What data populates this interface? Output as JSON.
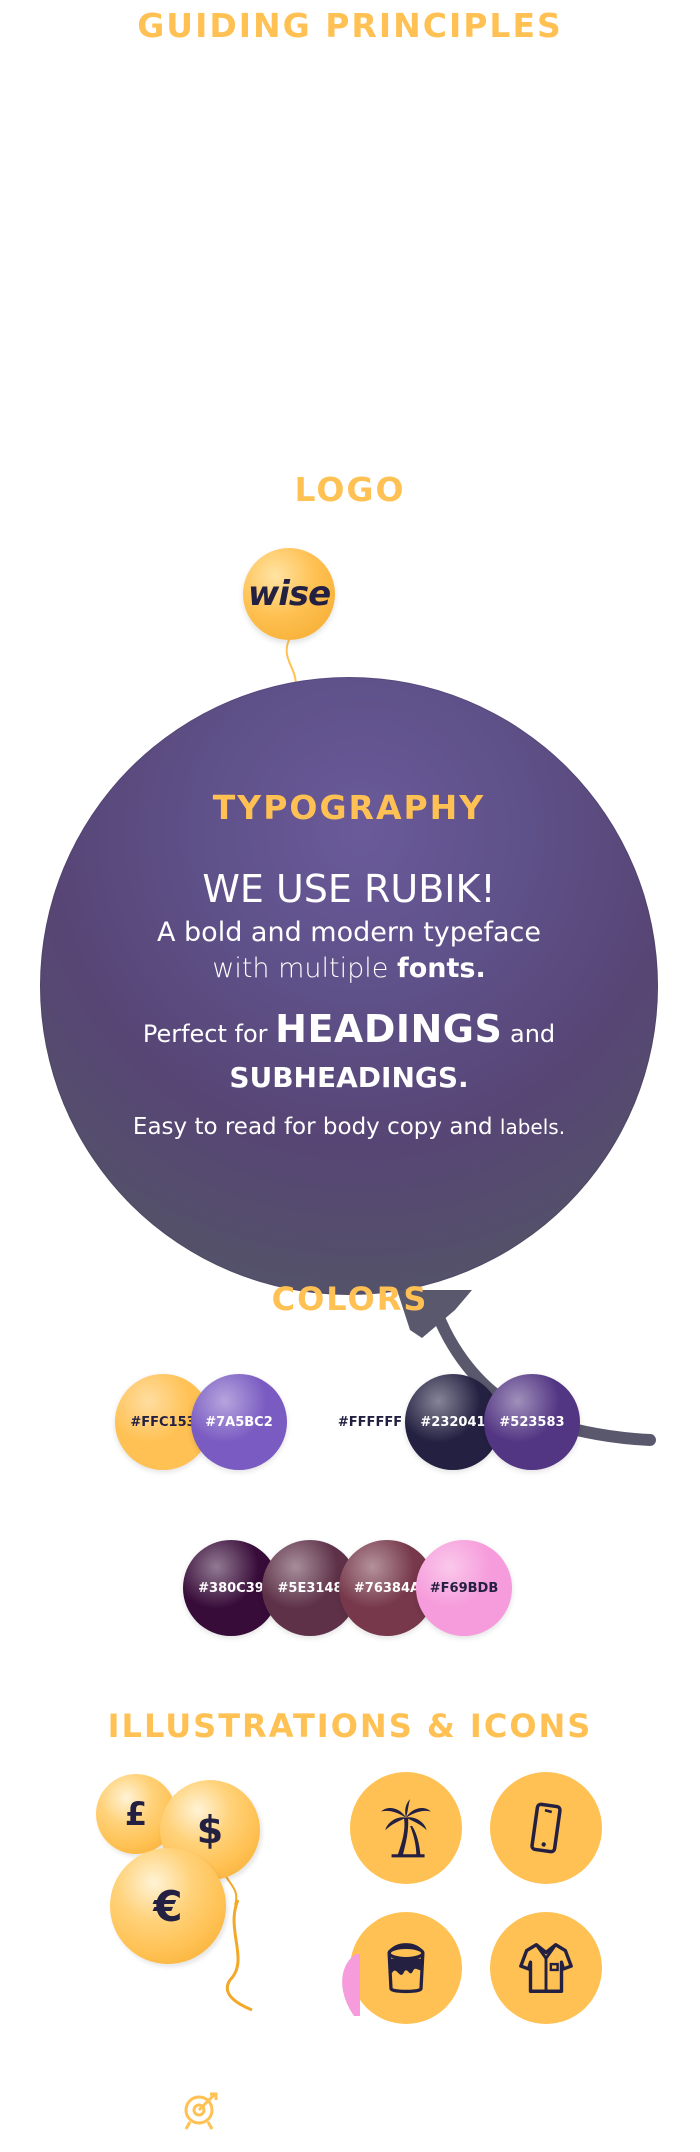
{
  "headings": {
    "guiding": "GUIDING  PRINCIPLES",
    "logo": "LOGO",
    "colors": "COLORS",
    "illustrations": "ILLUSTRATIONS & ICONS"
  },
  "logo": {
    "text": "wise",
    "color": "#FFC153"
  },
  "typography": {
    "title": "TYPOGRAPHY",
    "line1": "WE USE RUBIK!",
    "line2": "A bold and modern typeface",
    "line3_start": "with multiple ",
    "line3_bold": "fonts.",
    "line4_start": "Perfect for ",
    "line4_big": "HEADINGS",
    "line4_end": " and",
    "line5": "SUBHEADINGS.",
    "line6_start": "Easy to read for body copy and ",
    "line6_small": "labels."
  },
  "colors": {
    "row1": [
      {
        "label": "#FFC153",
        "hex": "#FFC153",
        "text": "#232041"
      },
      {
        "label": "#7A5BC2",
        "hex": "#7A5BC2",
        "text": "#FFFFFF"
      },
      {
        "label": "#FFFFFF",
        "hex": "#FFFFFF",
        "text": "#232041"
      },
      {
        "label": "#232041",
        "hex": "#232041",
        "text": "#FFFFFF"
      },
      {
        "label": "#523583",
        "hex": "#523583",
        "text": "#FFFFFF"
      }
    ],
    "row2": [
      {
        "label": "#380C39",
        "hex": "#380C39",
        "text": "#FFFFFF"
      },
      {
        "label": "#5E3148",
        "hex": "#5E3148",
        "text": "#FFFFFF"
      },
      {
        "label": "#76384A",
        "hex": "#76384A",
        "text": "#FFFFFF"
      },
      {
        "label": "#F69BDB",
        "hex": "#F69BDB",
        "text": "#232041"
      }
    ]
  },
  "currency": {
    "pound": "£",
    "dollar": "$",
    "euro": "€"
  },
  "icons": [
    "palm-tree-icon",
    "smartphone-icon",
    "paint-bucket-icon",
    "shirt-icon",
    "target-icon"
  ]
}
